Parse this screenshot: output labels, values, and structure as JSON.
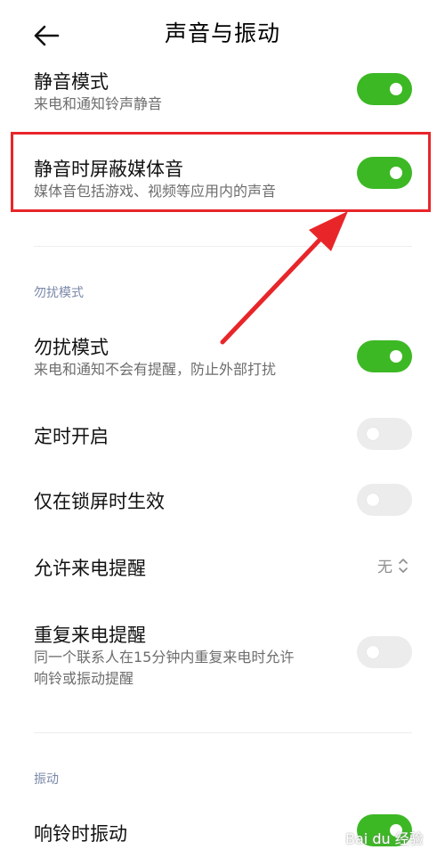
{
  "header": {
    "title": "声音与振动",
    "back_icon": "arrow-left-icon"
  },
  "rows": {
    "silent_mode": {
      "title": "静音模式",
      "desc": "来电和通知铃声静音",
      "on": true
    },
    "mute_media": {
      "title": "静音时屏蔽媒体音",
      "desc": "媒体音包括游戏、视频等应用内的声音",
      "on": true
    },
    "dnd_mode": {
      "title": "勿扰模式",
      "desc": "来电和通知不会有提醒，防止外部打扰",
      "on": true
    },
    "scheduled": {
      "title": "定时开启",
      "on": false
    },
    "lockscreen_only": {
      "title": "仅在锁屏时生效",
      "on": false
    },
    "allow_calls": {
      "title": "允许来电提醒",
      "value": "无"
    },
    "repeat_calls": {
      "title": "重复来电提醒",
      "desc_line1": "同一个联系人在15分钟内重复来电时允许",
      "desc_line2": "响铃或振动提醒",
      "on": false
    },
    "vibrate_ring": {
      "title": "响铃时振动",
      "on": true
    }
  },
  "sections": {
    "dnd": "勿扰模式",
    "vibration": "振动"
  },
  "colors": {
    "toggle_on": "#3cb824",
    "toggle_off": "#ececec",
    "highlight": "#e8262a",
    "section_label": "#7a88a8"
  },
  "watermark": {
    "text": "Bai du 经验"
  }
}
